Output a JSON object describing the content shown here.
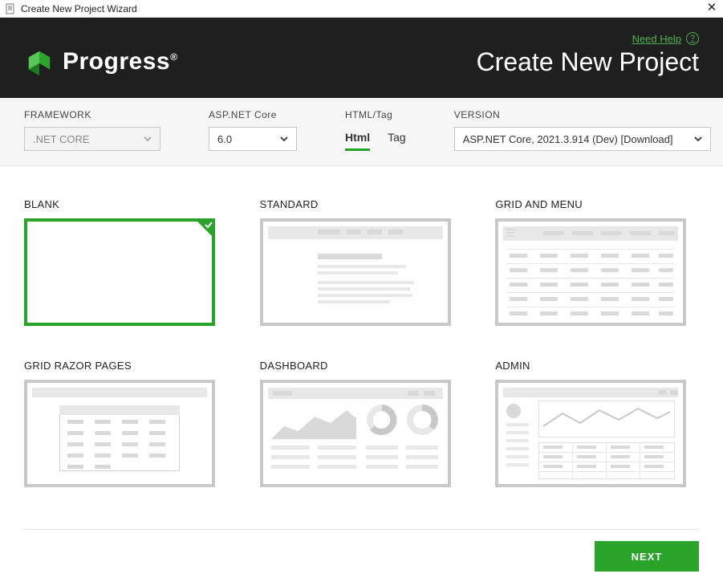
{
  "window": {
    "title": "Create New Project Wizard"
  },
  "header": {
    "need_help": "Need Help",
    "brand": "Progress",
    "page_title": "Create New Project"
  },
  "options": {
    "framework_label": "FRAMEWORK",
    "framework_value": ".NET CORE",
    "core_label": "ASP.NET Core",
    "core_value": "6.0",
    "htmltag_label": "HTML/Tag",
    "tab_html": "Html",
    "tab_tag": "Tag",
    "version_label": "VERSION",
    "version_value": "ASP.NET Core, 2021.3.914 (Dev) [Download]"
  },
  "templates": {
    "blank": "BLANK",
    "standard": "STANDARD",
    "grid_menu": "GRID AND MENU",
    "grid_razor": "GRID RAZOR PAGES",
    "dashboard": "DASHBOARD",
    "admin": "ADMIN"
  },
  "footer": {
    "next": "NEXT"
  }
}
